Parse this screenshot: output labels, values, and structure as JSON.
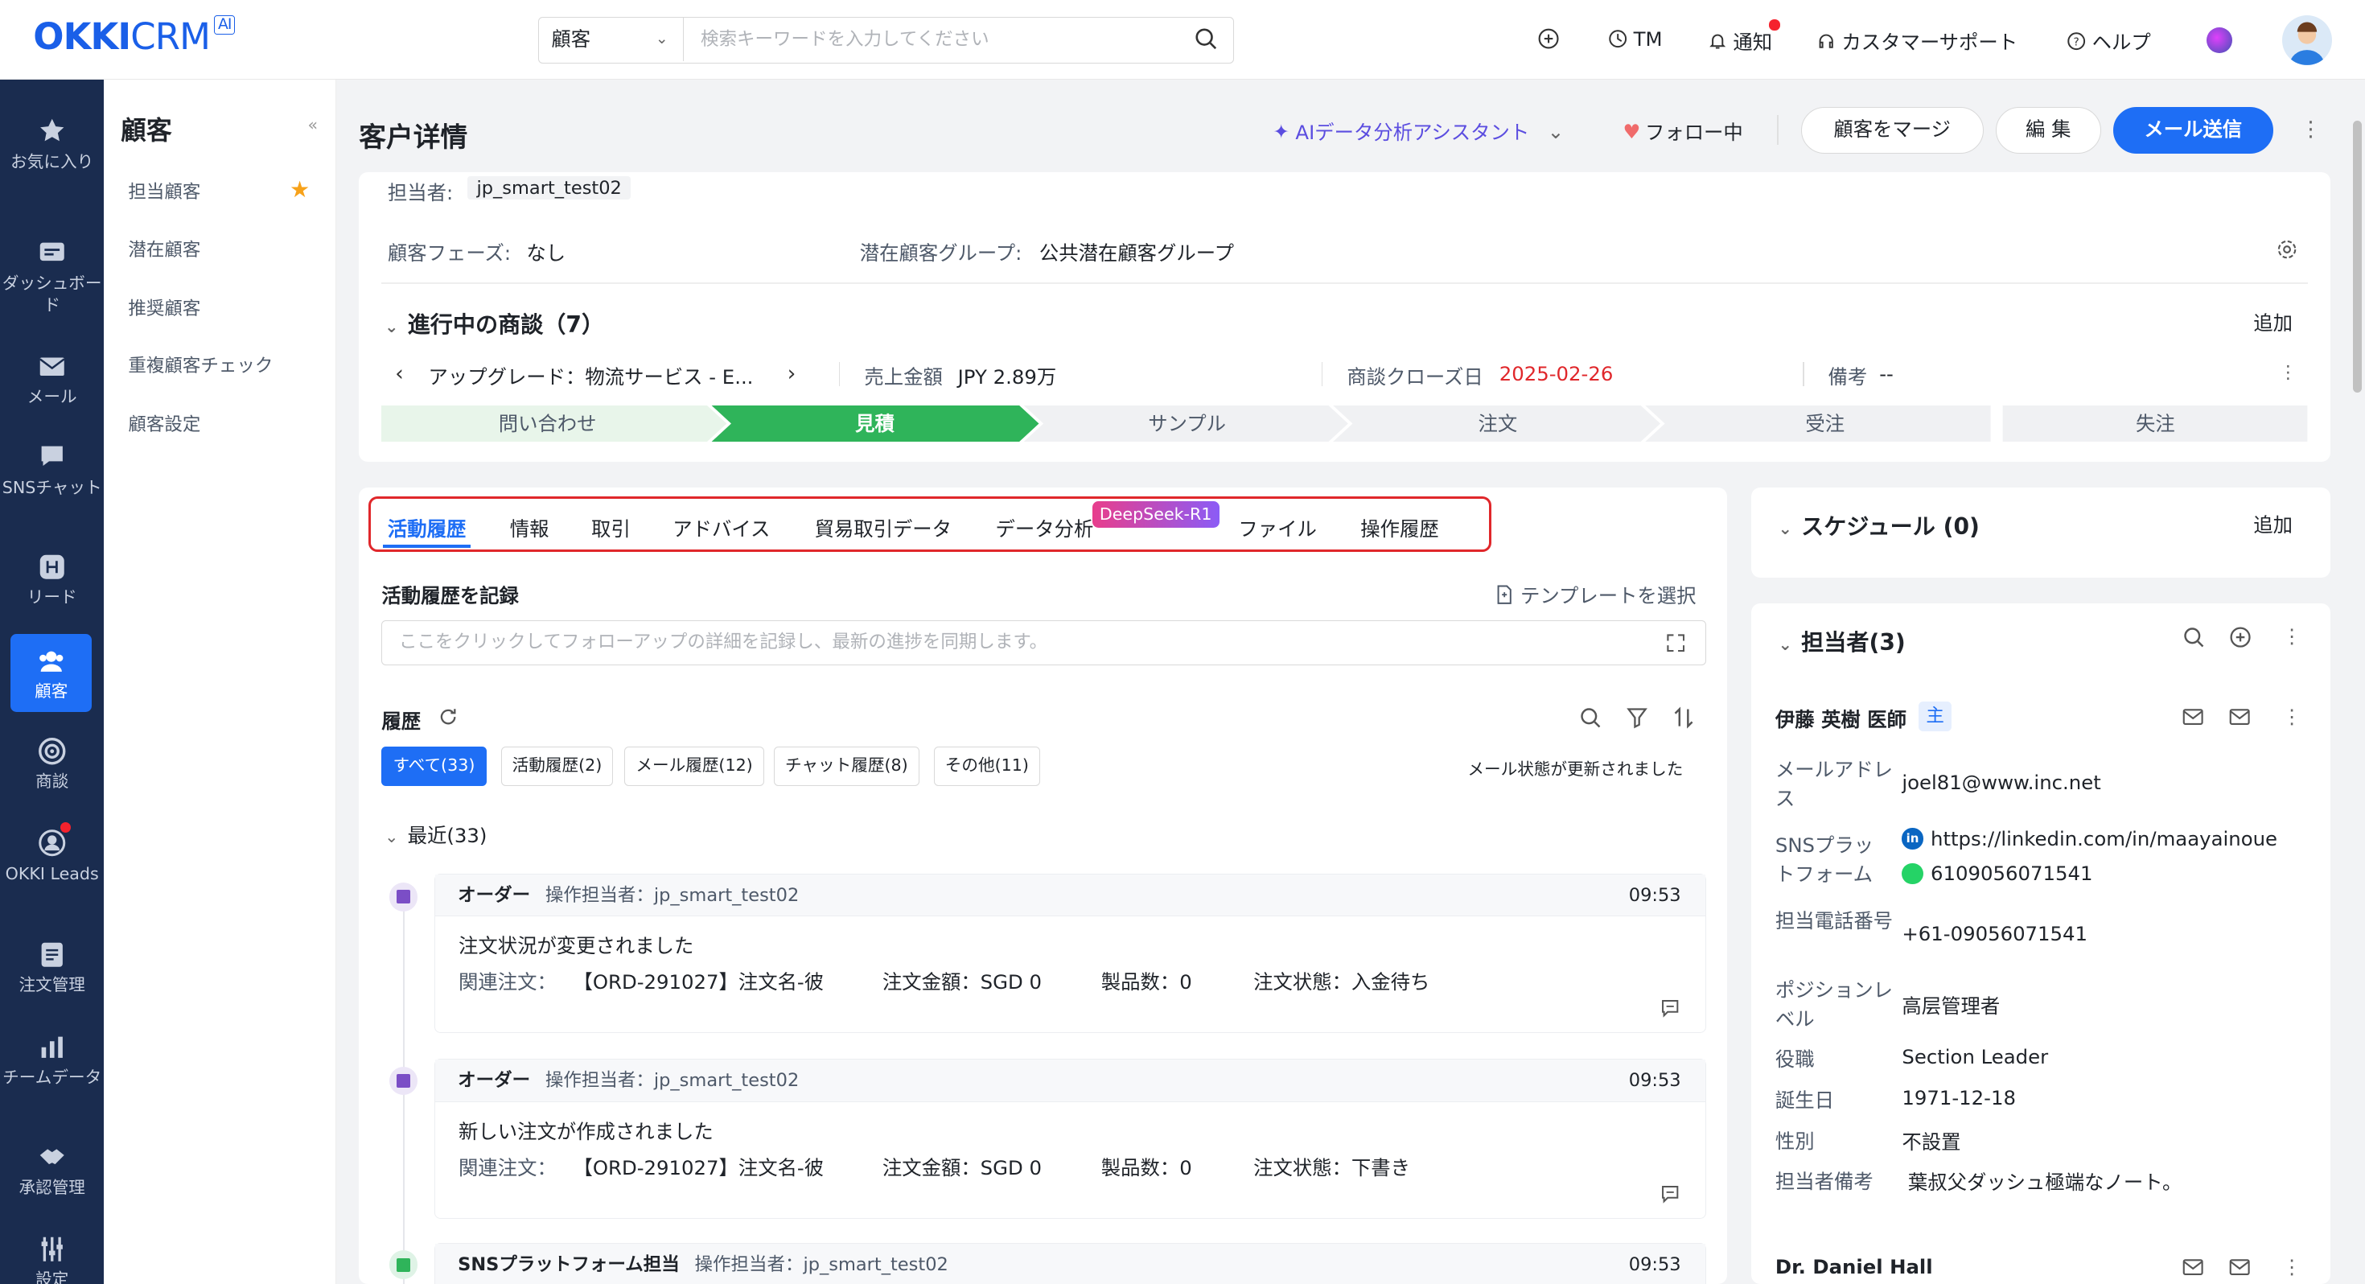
{
  "app": {
    "logo_main": "OKKI",
    "logo_crm": "CRM",
    "logo_ai": "AI"
  },
  "search": {
    "category": "顧客",
    "placeholder": "検索キーワードを入力してください"
  },
  "topbar": {
    "tm": "TM",
    "notify": "通知",
    "support": "カスタマーサポート",
    "help": "ヘルプ"
  },
  "nav": [
    {
      "label": "お気に入り"
    },
    {
      "label": "ダッシュボード"
    },
    {
      "label": "メール"
    },
    {
      "label": "SNSチャット"
    },
    {
      "label": "リード"
    },
    {
      "label": "顧客"
    },
    {
      "label": "商談"
    },
    {
      "label": "OKKI Leads"
    },
    {
      "label": "注文管理"
    },
    {
      "label": "チームデータ"
    },
    {
      "label": "承認管理"
    },
    {
      "label": "設定"
    }
  ],
  "subnav": {
    "title": "顧客",
    "items": [
      "担当顧客",
      "潜在顧客",
      "推奨顧客",
      "重複顧客チェック",
      "顧客設定"
    ]
  },
  "header": {
    "title": "客户详情",
    "ai": "AIデータ分析アシスタント",
    "follow": "フォロー中",
    "merge": "顧客をマージ",
    "edit": "編 集",
    "send": "メール送信"
  },
  "info": {
    "owner_label": "担当者:",
    "owner": "jp_smart_test02",
    "phase_label": "顧客フェーズ:",
    "phase": "なし",
    "group_label": "潜在顧客グループ:",
    "group": "公共潜在顧客グループ"
  },
  "deals": {
    "title": "進行中の商談（7）",
    "add": "追加",
    "name": "アップグレード：物流サービス - E...",
    "amount_label": "売上金額",
    "amount": "JPY 2.89万",
    "close_label": "商談クローズ日",
    "close": "2025-02-26",
    "note_label": "備考",
    "note": "--",
    "stages": [
      "問い合わせ",
      "見積",
      "サンプル",
      "注文",
      "受注",
      "失注"
    ]
  },
  "tabs": {
    "items": [
      "活動履歴",
      "情報",
      "取引",
      "アドバイス",
      "貿易取引データ",
      "データ分析",
      "ファイル",
      "操作履歴"
    ],
    "badge": "DeepSeek-R1"
  },
  "record": {
    "title": "活動履歴を記録",
    "template": "テンプレートを選択",
    "placeholder": "ここをクリックしてフォローアップの詳細を記録し、最新の進捗を同期します。"
  },
  "history": {
    "title": "履歴",
    "status": "メール状態が更新されました",
    "filters": [
      "すべて(33)",
      "活動履歴(2)",
      "メール履歴(12)",
      "チャット履歴(8)",
      "その他(11)"
    ],
    "recent": "最近(33)"
  },
  "entries": [
    {
      "type": "オーダー",
      "op": "操作担当者：jp_smart_test02",
      "time": "09:53",
      "title": "注文状況が変更されました",
      "rel_label": "関連注文：",
      "rel": "【ORD-291027】注文名-彼",
      "amt": "注文金額：SGD 0",
      "qty": "製品数：0",
      "state": "注文状態：入金待ち"
    },
    {
      "type": "オーダー",
      "op": "操作担当者：jp_smart_test02",
      "time": "09:53",
      "title": "新しい注文が作成されました",
      "rel_label": "関連注文：",
      "rel": "【ORD-291027】注文名-彼",
      "amt": "注文金額：SGD 0",
      "qty": "製品数：0",
      "state": "注文状態：下書き"
    },
    {
      "type": "SNSプラットフォーム担当",
      "op": "操作担当者：jp_smart_test02",
      "time": "09:53"
    }
  ],
  "schedule": {
    "title": "スケジュール (0)",
    "add": "追加"
  },
  "contacts": {
    "title": "担当者(3)",
    "name": "伊藤 英樹 医師",
    "badge": "主",
    "fields": [
      {
        "label": "メールアドレス",
        "value": "joel81@www.inc.net"
      },
      {
        "label": "SNSプラットフォーム",
        "value": "https://linkedin.com/in/maayainoue",
        "value2": "6109056071541"
      },
      {
        "label": "担当電話番号",
        "value": "+61-09056071541"
      },
      {
        "label": "ポジションレベル",
        "value": "高层管理者"
      },
      {
        "label": "役職",
        "value": "Section Leader"
      },
      {
        "label": "誕生日",
        "value": "1971-12-18"
      },
      {
        "label": "性別",
        "value": "不設置"
      },
      {
        "label": "担当者備考",
        "value": "葉叔父ダッシュ極端なノート。"
      }
    ],
    "second": "Dr. Daniel Hall"
  },
  "colors": {
    "accent": "#1e6ef5",
    "nav_bg": "#1a2c4f",
    "stage_done": "#e8f5ea",
    "stage_active": "#2fb45a",
    "danger": "#e0272b"
  }
}
